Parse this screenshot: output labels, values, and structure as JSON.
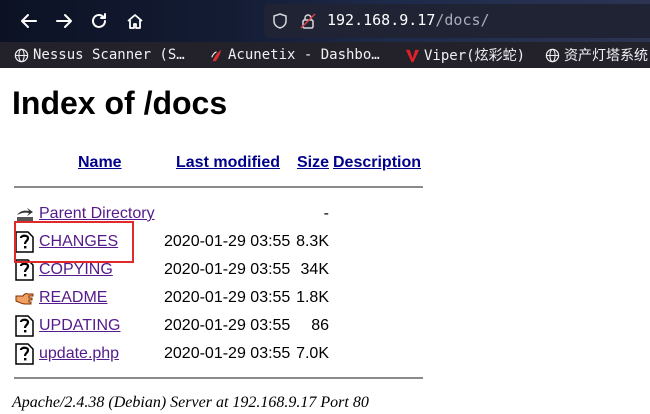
{
  "browser": {
    "url_host": "192.168.9.17",
    "url_path": "/docs/"
  },
  "bookmarks": [
    {
      "label": "Nessus Scanner (S…",
      "icon": "globe-icon"
    },
    {
      "label": "Acunetix - Dashbo…",
      "icon": "acunetix-icon"
    },
    {
      "label": "Viper(炫彩蛇)",
      "icon": "viper-icon"
    },
    {
      "label": "资产灯塔系统",
      "icon": "globe-icon"
    }
  ],
  "page": {
    "title": "Index of /docs",
    "columns": {
      "name": "Name",
      "last_modified": "Last modified",
      "size": "Size",
      "description": "Description"
    },
    "entries": [
      {
        "name": "Parent Directory",
        "modified": "",
        "size": "-",
        "icon": "back-arrow-icon"
      },
      {
        "name": "CHANGES",
        "modified": "2020-01-29 03:55",
        "size": "8.3K",
        "icon": "unknown-file-icon"
      },
      {
        "name": "COPYING",
        "modified": "2020-01-29 03:55",
        "size": "34K",
        "icon": "unknown-file-icon"
      },
      {
        "name": "README",
        "modified": "2020-01-29 03:55",
        "size": "1.8K",
        "icon": "hand-pointer-icon"
      },
      {
        "name": "UPDATING",
        "modified": "2020-01-29 03:55",
        "size": "86",
        "icon": "unknown-file-icon"
      },
      {
        "name": "update.php",
        "modified": "2020-01-29 03:55",
        "size": "7.0K",
        "icon": "unknown-file-icon"
      }
    ],
    "server_signature": "Apache/2.4.38 (Debian) Server at 192.168.9.17 Port 80"
  },
  "colors": {
    "link_visited": "#551a8b",
    "header_link": "#00008b",
    "highlight_box": "#e02a2a"
  }
}
